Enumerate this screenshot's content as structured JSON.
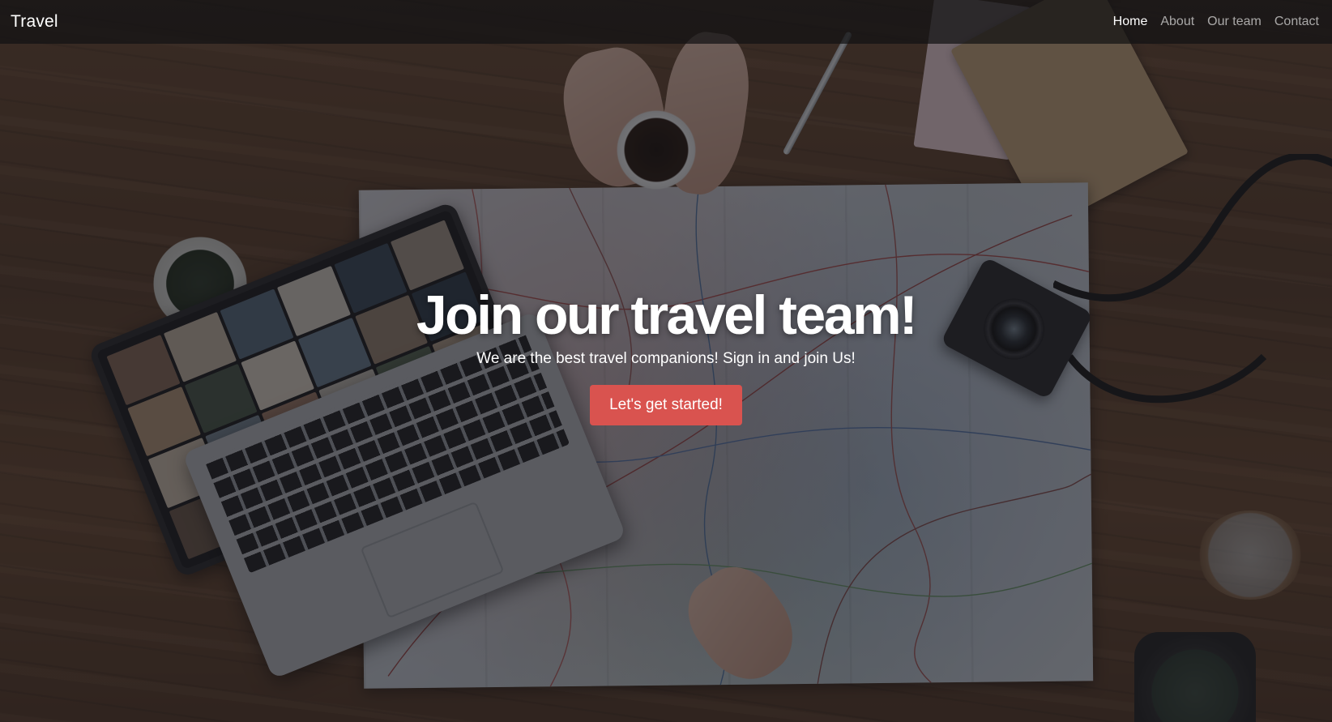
{
  "navbar": {
    "brand": "Travel",
    "links": [
      {
        "label": "Home",
        "active": true
      },
      {
        "label": "About",
        "active": false
      },
      {
        "label": "Our team",
        "active": false
      },
      {
        "label": "Contact",
        "active": false
      }
    ]
  },
  "hero": {
    "title": "Join our travel team!",
    "subtitle": "We are the best travel companions! Sign in and join Us!",
    "cta_label": "Let's get started!"
  },
  "colors": {
    "cta_background": "#d9534f",
    "navbar_background": "#121214",
    "text": "#ffffff"
  }
}
